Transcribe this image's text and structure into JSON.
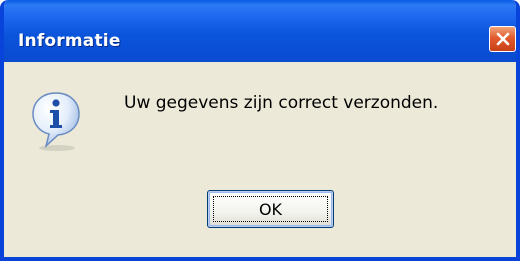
{
  "dialog": {
    "title": "Informatie",
    "message": "Uw gegevens zijn correct verzonden.",
    "icon": "information-icon",
    "ok_label": "OK",
    "close_icon": "close-icon"
  },
  "colors": {
    "titlebar": "#0A55DC",
    "frame": "#0843DA",
    "body": "#ECE9D8",
    "close_button": "#E25A2C"
  }
}
